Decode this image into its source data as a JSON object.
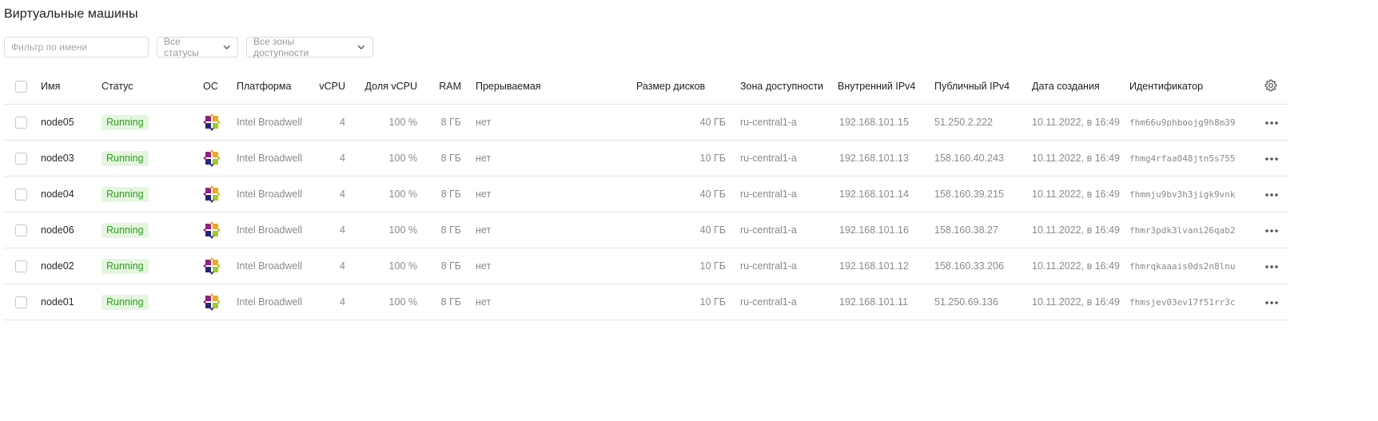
{
  "page": {
    "title": "Виртуальные машины"
  },
  "filters": {
    "name_placeholder": "Фильтр по имени",
    "status_value": "Все статусы",
    "zone_value": "Все зоны доступности"
  },
  "table": {
    "columns": {
      "name": "Имя",
      "status": "Статус",
      "os": "ОС",
      "platform": "Платформа",
      "vcpu": "vCPU",
      "vcpu_share": "Доля vCPU",
      "ram": "RAM",
      "preemptible": "Прерываемая",
      "disk_size": "Размер дисков",
      "zone": "Зона доступности",
      "internal_ip": "Внутренний IPv4",
      "public_ip": "Публичный IPv4",
      "created": "Дата создания",
      "id": "Идентификатор"
    },
    "rows": [
      {
        "name": "node05",
        "status": "Running",
        "os": "centos-icon",
        "platform": "Intel Broadwell",
        "vcpu": "4",
        "vcpu_share": "100 %",
        "ram": "8 ГБ",
        "preemptible": "нет",
        "disk_size": "40 ГБ",
        "zone": "ru-central1-a",
        "internal_ip": "192.168.101.15",
        "public_ip": "51.250.2.222",
        "created": "10.11.2022, в 16:49",
        "id": "fhm66u9phboojg9h8m39"
      },
      {
        "name": "node03",
        "status": "Running",
        "os": "centos-icon",
        "platform": "Intel Broadwell",
        "vcpu": "4",
        "vcpu_share": "100 %",
        "ram": "8 ГБ",
        "preemptible": "нет",
        "disk_size": "10 ГБ",
        "zone": "ru-central1-a",
        "internal_ip": "192.168.101.13",
        "public_ip": "158.160.40.243",
        "created": "10.11.2022, в 16:49",
        "id": "fhmg4rfaa048jtn5s755"
      },
      {
        "name": "node04",
        "status": "Running",
        "os": "centos-icon",
        "platform": "Intel Broadwell",
        "vcpu": "4",
        "vcpu_share": "100 %",
        "ram": "8 ГБ",
        "preemptible": "нет",
        "disk_size": "40 ГБ",
        "zone": "ru-central1-a",
        "internal_ip": "192.168.101.14",
        "public_ip": "158.160.39.215",
        "created": "10.11.2022, в 16:49",
        "id": "fhmmju9bv3h3jigk9vnk"
      },
      {
        "name": "node06",
        "status": "Running",
        "os": "centos-icon",
        "platform": "Intel Broadwell",
        "vcpu": "4",
        "vcpu_share": "100 %",
        "ram": "8 ГБ",
        "preemptible": "нет",
        "disk_size": "40 ГБ",
        "zone": "ru-central1-a",
        "internal_ip": "192.168.101.16",
        "public_ip": "158.160.38.27",
        "created": "10.11.2022, в 16:49",
        "id": "fhmr3pdk3lvani26qab2"
      },
      {
        "name": "node02",
        "status": "Running",
        "os": "centos-icon",
        "platform": "Intel Broadwell",
        "vcpu": "4",
        "vcpu_share": "100 %",
        "ram": "8 ГБ",
        "preemptible": "нет",
        "disk_size": "10 ГБ",
        "zone": "ru-central1-a",
        "internal_ip": "192.168.101.12",
        "public_ip": "158.160.33.206",
        "created": "10.11.2022, в 16:49",
        "id": "fhmrqkaaais0ds2n8lnu"
      },
      {
        "name": "node01",
        "status": "Running",
        "os": "centos-icon",
        "platform": "Intel Broadwell",
        "vcpu": "4",
        "vcpu_share": "100 %",
        "ram": "8 ГБ",
        "preemptible": "нет",
        "disk_size": "10 ГБ",
        "zone": "ru-central1-a",
        "internal_ip": "192.168.101.11",
        "public_ip": "51.250.69.136",
        "created": "10.11.2022, в 16:49",
        "id": "fhmsjev03ev17f51rr3c"
      }
    ]
  },
  "colors": {
    "status_running_bg": "#e5f6e0",
    "status_running_text": "#2e9e1f"
  },
  "icons": {
    "settings": "gear-icon",
    "row_menu": "more-actions-icon",
    "dropdown": "chevron-down-icon"
  }
}
